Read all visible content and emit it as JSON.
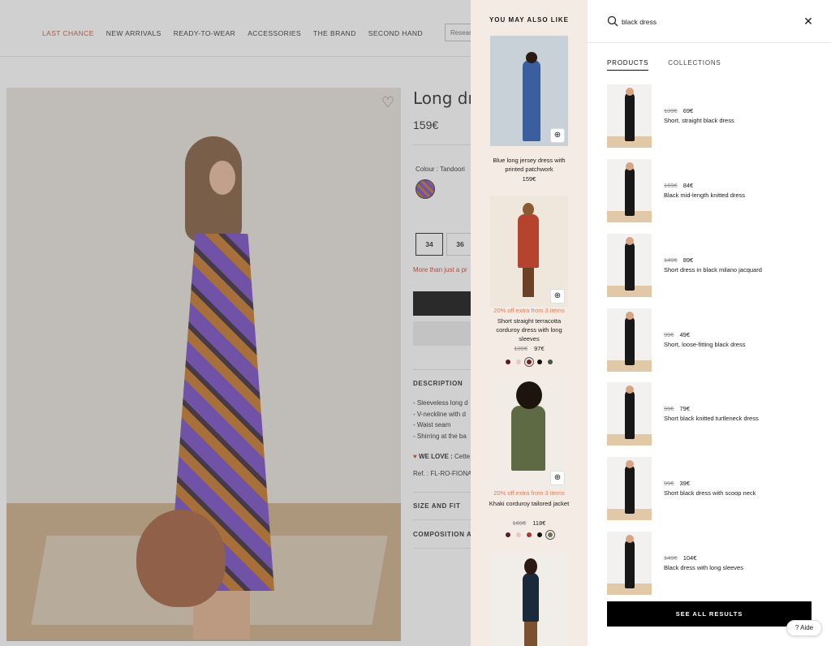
{
  "nav": {
    "items": [
      "LAST CHANCE",
      "NEW ARRIVALS",
      "READY-TO-WEAR",
      "ACCESSORIES",
      "THE BRAND",
      "SECOND HAND"
    ],
    "search_placeholder": "Research"
  },
  "product": {
    "title": "Long dress",
    "price": "159€",
    "colour_label": "Colour :  Tandoori",
    "sizes": [
      "34",
      "36"
    ],
    "stock_note": "More than just a pr",
    "sections": {
      "description": "DESCRIPTION",
      "size_fit": "SIZE AND FIT",
      "composition": "COMPOSITION AN"
    },
    "description_lines": [
      "- Sleeveless long d",
      "- V-neckline with d",
      "- Waist seam",
      "- Shirring at the ba"
    ],
    "we_love_label": "WE LOVE :",
    "we_love_text": "Cette",
    "ref": "Ref. : FL-RO-FIONA"
  },
  "ymal": {
    "title": "YOU MAY ALSO LIKE",
    "items": [
      {
        "name": "Blue long jersey dress with printed patchwork",
        "price": "159€"
      },
      {
        "promo": "20% off extra from 3 items",
        "name": "Short straight terracotta corduroy dress with long sleeves",
        "old_price": "139€",
        "price": "97€",
        "swatches": [
          "#5a1a26",
          "#e8c9c0",
          "#6e1f1f",
          "#111111",
          "#3f5a3e"
        ]
      },
      {
        "promo": "20% off extra from 3 items",
        "name": "Khaki corduroy tailored jacket",
        "old_price": "169€",
        "price": "118€",
        "swatches": [
          "#5a1a26",
          "#e8c9c0",
          "#a33a2a",
          "#111111",
          "#6b7355"
        ]
      }
    ]
  },
  "search": {
    "query": "black dress",
    "tabs": [
      "PRODUCTS",
      "COLLECTIONS"
    ],
    "results": [
      {
        "old_price": "139€",
        "price": "69€",
        "name": "Short, straight black dress"
      },
      {
        "old_price": "169€",
        "price": "84€",
        "name": "Black mid-length knitted dress"
      },
      {
        "old_price": "149€",
        "price": "89€",
        "name": "Short dress in black milano jacquard"
      },
      {
        "old_price": "99€",
        "price": "49€",
        "name": "Short, loose-fitting black dress"
      },
      {
        "old_price": "99€",
        "price": "79€",
        "name": "Short black knitted turtleneck dress"
      },
      {
        "old_price": "99€",
        "price": "39€",
        "name": "Short black dress with scoop neck"
      },
      {
        "old_price": "149€",
        "price": "104€",
        "name": "Black dress with long sleeves"
      }
    ],
    "see_all": "SEE ALL RESULTS"
  },
  "help": {
    "label": "Aide"
  },
  "colors": {
    "accent": "#c04a2a",
    "promo": "#e07b5a",
    "ymal_bg": "#f4ece4"
  }
}
